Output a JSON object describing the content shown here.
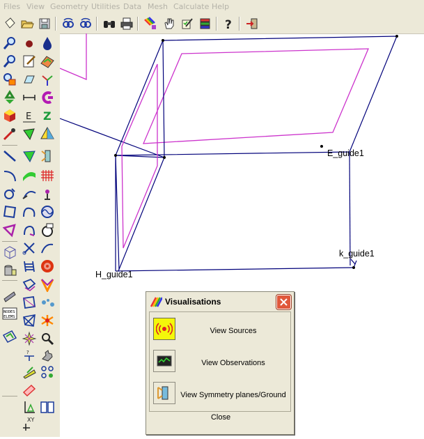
{
  "menu": {
    "items": [
      "Files",
      "View",
      "Geometry",
      "Utilities",
      "Data",
      "Mesh",
      "Calculate",
      "Help"
    ]
  },
  "toolbar": {
    "buttons": [
      "new-document-icon",
      "open-folder-icon",
      "save-disk-icon",
      "zoom-link-icon",
      "zoom-link-alt-icon",
      "binoculars-icon",
      "print-icon",
      "rainbow-icon",
      "hand-pan-icon",
      "edit-check-icon",
      "layers-stack-icon",
      "help-icon",
      "exit-icon"
    ]
  },
  "palette": {
    "tools": [
      "zoom-in-icon",
      "point-marker-icon",
      "fill-drop-icon",
      "zoom-out-icon",
      "notepad-icon",
      "color-shape-icon",
      "zoom-region-icon",
      "prism-icon",
      "axes-icon",
      "recycle-icon",
      "dimension-icon",
      "c-shape-icon",
      "cube-color-icon",
      "e-label-icon",
      "z-label-icon",
      "pipette-icon",
      "polygon-tool-icon",
      "pyramid-icon",
      "line-tool-icon",
      "polygon-green-icon",
      "symmetry-icon",
      "arc-tool-icon",
      "surface-green-icon",
      "grid-red-icon",
      "circle-arrow-icon",
      "antenna-icon",
      "antenna-small-icon",
      "square-nodes-icon",
      "curve-tool-icon",
      "sine-wave-icon",
      "shape-magenta-icon",
      "curve-nodes-icon",
      "probe-icon",
      "cube-wire-icon",
      "scissors-icon",
      "path-icon",
      "cylinder-icon",
      "ladder-icon",
      "sphere-red-icon",
      "box-icon",
      "mesh-blue-icon",
      "y-shape-icon",
      "plane-tool-icon",
      "shape-edit-icon",
      "magnifier-points-icon",
      "nodes-elems-icon",
      "mesh-edit-icon",
      "star-mesh-icon",
      "mesh-green-icon",
      "star-tool-icon",
      "magnifier-icon",
      "curve-lock-icon",
      "wrench-icon",
      "coordinate-icon",
      "plate-green-icon",
      "chain-icon",
      "grid-plate-icon",
      "ruler-icon",
      "book-icon",
      "axes-xy-icon"
    ]
  },
  "viewport": {
    "labels": {
      "e_guide": "E_guide1",
      "h_guide": "H_guide1",
      "k_guide": "k_guide1"
    },
    "colors": {
      "geometry": "#00007a",
      "inner_frame": "#cc33cc"
    }
  },
  "dialog": {
    "title": "Visualisations",
    "items": [
      {
        "label": "View Sources",
        "icon": "source-antenna-icon",
        "active": true
      },
      {
        "label": "View Observations",
        "icon": "observation-monitor-icon",
        "active": false
      },
      {
        "label": "View Symmetry planes/Ground",
        "icon": "symmetry-plane-icon",
        "active": false
      }
    ],
    "close_label": "Close"
  }
}
